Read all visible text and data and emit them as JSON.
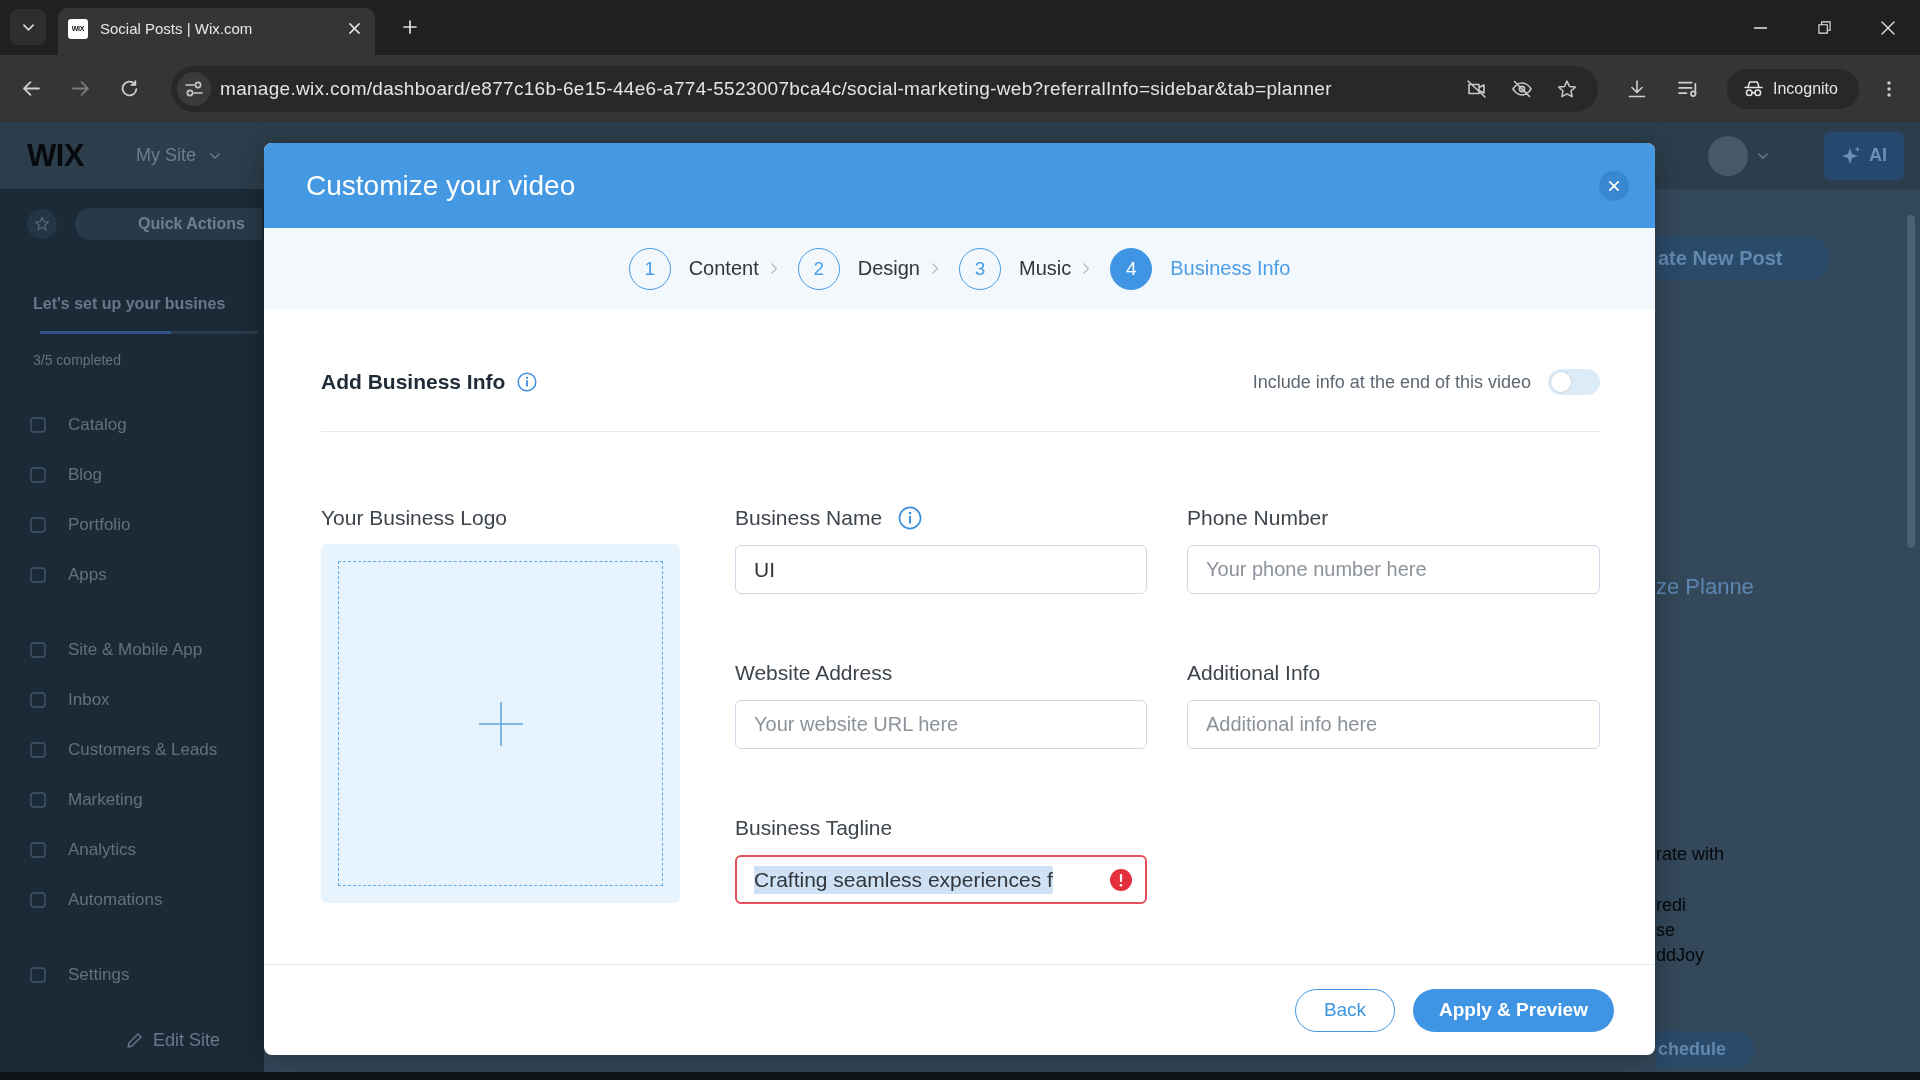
{
  "browser": {
    "tab": {
      "favicon_text": "WIX",
      "title": "Social Posts | Wix.com"
    },
    "nav": {
      "back_disabled": false,
      "forward_disabled": true
    },
    "url": "manage.wix.com/dashboard/e877c16b-6e15-44e6-a774-5523007bca4c/social-marketing-web?referralInfo=sidebar&tab=planner",
    "bookmarked": false,
    "profile": "Incognito"
  },
  "dashboard": {
    "logo": "WIX",
    "site_menu": "My Site",
    "quick_actions": "Quick Actions",
    "setup": {
      "title": "Let's set up your busines",
      "level": 0.6,
      "progress_text": "3/5 completed"
    },
    "nav_groups": [
      {
        "items": [
          "Catalog",
          "Blog",
          "Portfolio",
          "Apps"
        ]
      },
      {
        "items": [
          "Site & Mobile App",
          "Inbox",
          "Customers & Leads",
          "Marketing",
          "Analytics",
          "Automations"
        ]
      },
      {
        "items": [
          "Settings"
        ]
      }
    ],
    "edit_site": "Edit Site",
    "ai_button": "AI",
    "create_post_button": "ate New Post",
    "planner_heading": "ze Planne",
    "integration_text": "rate with",
    "partner_lines": [
      "redi",
      "se",
      "ddJoy"
    ],
    "schedule_button": "chedule"
  },
  "modal": {
    "title": "Customize your video",
    "steps": [
      {
        "number": "1",
        "label": "Content",
        "selected": false
      },
      {
        "number": "2",
        "label": "Design",
        "selected": false
      },
      {
        "number": "3",
        "label": "Music",
        "selected": false
      },
      {
        "number": "4",
        "label": "Business Info",
        "selected": true
      }
    ],
    "section": {
      "title": "Add Business Info",
      "info": true,
      "toggle": {
        "label": "Include info at the end of this video",
        "on": false
      }
    },
    "logo_upload": {
      "label": "Your Business Logo"
    },
    "field_columns": [
      {
        "fields": [
          {
            "label": "Business Name",
            "info": true,
            "value": "UI",
            "text_selected": false,
            "error": false
          },
          {
            "label": "Website Address",
            "placeholder": "Your website URL here",
            "error": false
          },
          {
            "label": "Business Tagline",
            "value": "Crafting seamless experiences f",
            "text_selected": true,
            "error": true
          }
        ]
      },
      {
        "fields": [
          {
            "label": "Phone Number",
            "placeholder": "Your phone number here",
            "error": false
          },
          {
            "label": "Additional Info",
            "placeholder": "Additional info here",
            "error": false
          }
        ]
      }
    ],
    "buttons": [
      {
        "kind": "secondary",
        "label": "Back"
      },
      {
        "kind": "primary",
        "label": "Apply & Preview"
      }
    ]
  }
}
